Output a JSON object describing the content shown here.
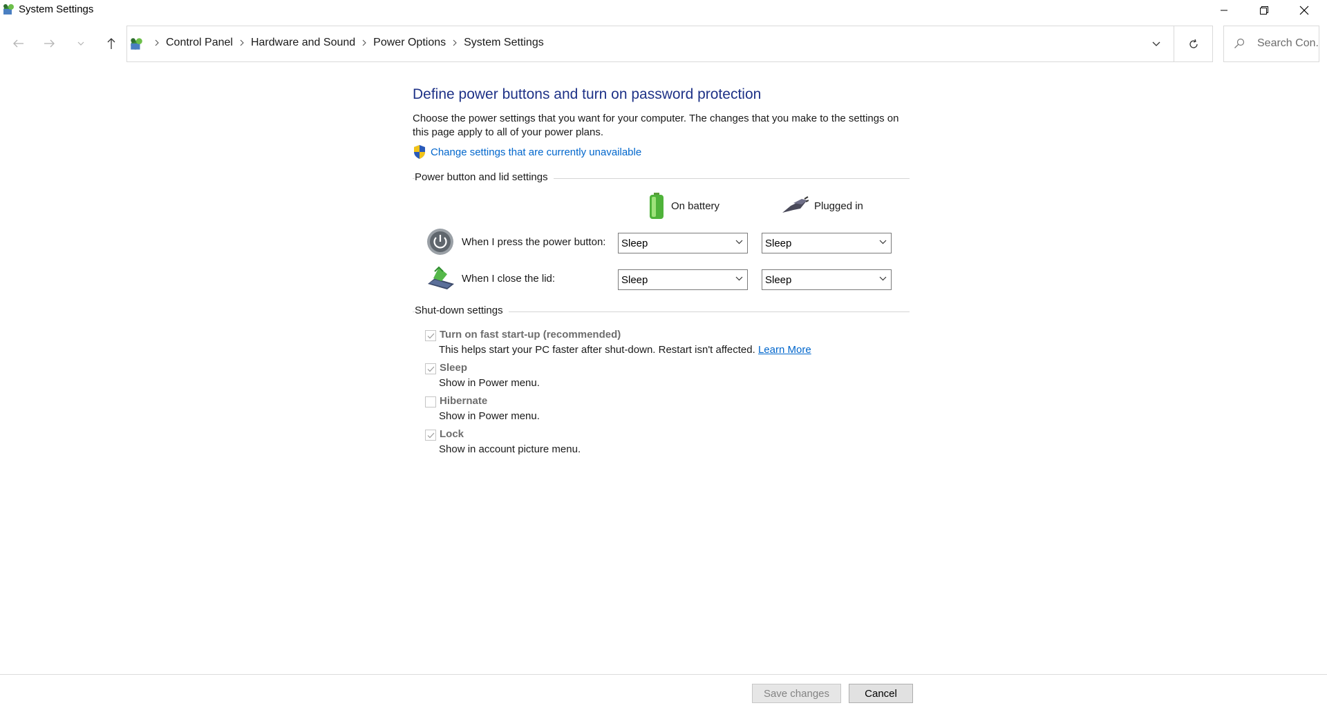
{
  "window": {
    "title": "System Settings"
  },
  "nav": {
    "breadcrumbs": [
      "Control Panel",
      "Hardware and Sound",
      "Power Options",
      "System Settings"
    ],
    "search_placeholder": "Search Con..."
  },
  "page": {
    "heading": "Define power buttons and turn on password protection",
    "intro": "Choose the power settings that you want for your computer. The changes that you make to the settings on this page apply to all of your power plans.",
    "change_link": "Change settings that are currently unavailable"
  },
  "power_section": {
    "label": "Power button and lid settings",
    "columns": {
      "battery": "On battery",
      "plugged": "Plugged in"
    },
    "rows": [
      {
        "label": "When I press the power button:",
        "battery": "Sleep",
        "plugged": "Sleep"
      },
      {
        "label": "When I close the lid:",
        "battery": "Sleep",
        "plugged": "Sleep"
      }
    ]
  },
  "shutdown_section": {
    "label": "Shut-down settings",
    "items": [
      {
        "title": "Turn on fast start-up (recommended)",
        "desc": "This helps start your PC faster after shut-down. Restart isn't affected.",
        "link": "Learn More",
        "checked": true
      },
      {
        "title": "Sleep",
        "desc": "Show in Power menu.",
        "checked": true
      },
      {
        "title": "Hibernate",
        "desc": "Show in Power menu.",
        "checked": false
      },
      {
        "title": "Lock",
        "desc": "Show in account picture menu.",
        "checked": true
      }
    ]
  },
  "footer": {
    "save_label": "Save changes",
    "cancel_label": "Cancel"
  },
  "colors": {
    "heading": "#1e3287",
    "link": "#0066cc"
  }
}
